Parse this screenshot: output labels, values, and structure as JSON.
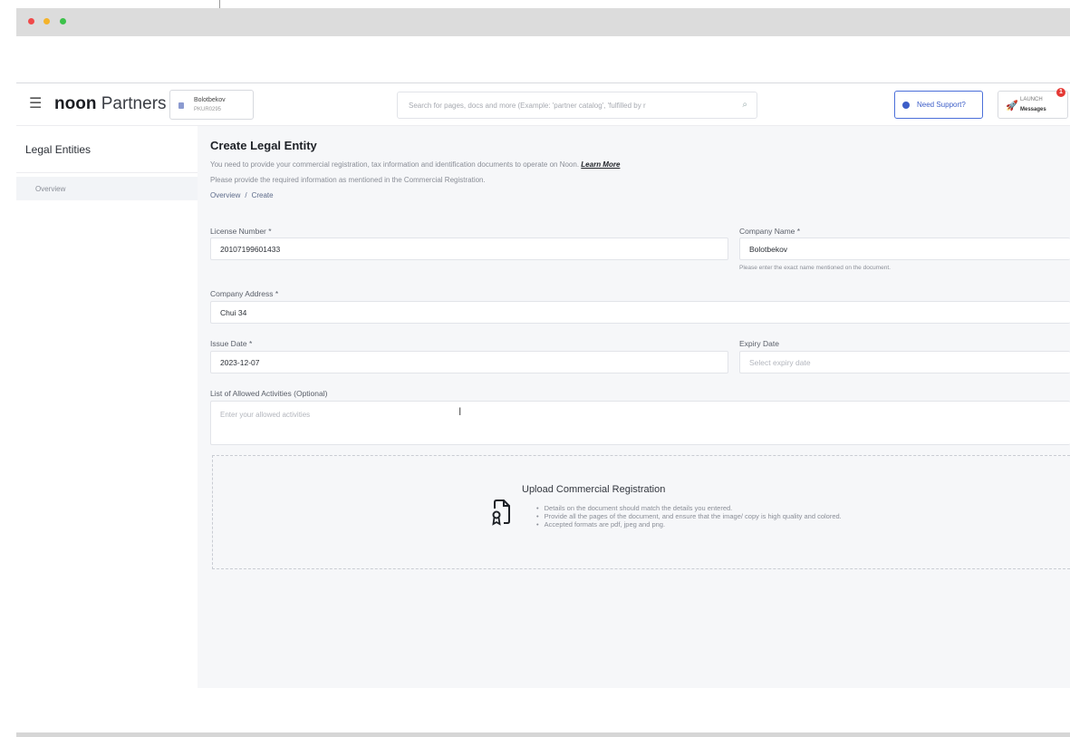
{
  "header": {
    "logo_bold": "noon",
    "logo_rest": " Partners",
    "account_name": "Bolotbekov",
    "account_id": "PKUR0295",
    "search_placeholder": "Search for pages, docs and more (Example: 'partner catalog', 'fulfilled by r",
    "support_label": "Need Support?",
    "launch_top": "LAUNCH",
    "launch_bottom": "Messages",
    "notification_count": "1"
  },
  "sidebar": {
    "title": "Legal Entities",
    "items": [
      {
        "label": "Overview"
      }
    ]
  },
  "main": {
    "title": "Create Legal Entity",
    "description_line1": "You need to provide your commercial registration, tax information and identification documents to operate on Noon.",
    "learn_more": "Learn More",
    "description_line2": "Please provide the required information as mentioned in the Commercial Registration.",
    "breadcrumb": [
      "Overview",
      "Create"
    ],
    "breadcrumb_sep": "/",
    "fields": {
      "license_number": {
        "label": "License Number *",
        "value": "20107199601433"
      },
      "company_name": {
        "label": "Company Name *",
        "value": "Bolotbekov",
        "hint": "Please enter the exact name mentioned on the document."
      },
      "company_address": {
        "label": "Company Address *",
        "value": "Chui 34"
      },
      "issue_date": {
        "label": "Issue Date *",
        "value": "2023-12-07"
      },
      "expiry_date": {
        "label": "Expiry Date",
        "placeholder": "Select expiry date"
      },
      "allowed_activities": {
        "label": "List of Allowed Activities (Optional)",
        "placeholder": "Enter your allowed activities"
      }
    },
    "upload": {
      "title": "Upload Commercial Registration",
      "bullets": [
        "Details on the document should match the details you entered.",
        "Provide all the pages of the document, and ensure that the image/ copy is high quality and colored.",
        "Accepted formats are pdf, jpeg and png."
      ]
    }
  },
  "colors": {
    "accent": "#3d5ec8",
    "badge": "#e53935",
    "page_bg": "#f6f7f9"
  }
}
